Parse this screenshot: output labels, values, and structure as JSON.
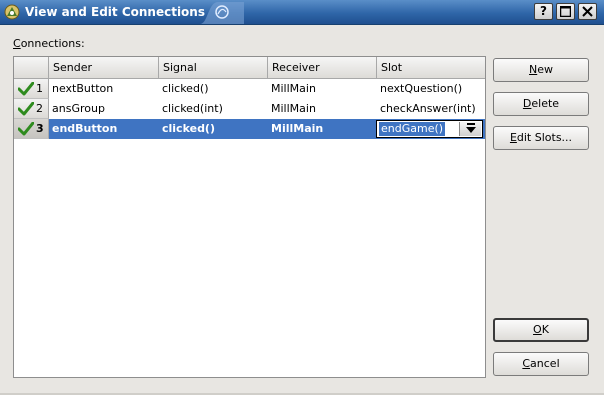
{
  "window": {
    "title": "View and Edit Connections",
    "help_label": "?"
  },
  "connections_label": "Connections:",
  "columns": [
    "Sender",
    "Signal",
    "Receiver",
    "Slot"
  ],
  "rows": [
    {
      "num": "1",
      "sender": "nextButton",
      "signal": "clicked()",
      "receiver": "MillMain",
      "slot": "nextQuestion()",
      "valid_icon": "check-icon"
    },
    {
      "num": "2",
      "sender": "ansGroup",
      "signal": "clicked(int)",
      "receiver": "MillMain",
      "slot": "checkAnswer(int)",
      "valid_icon": "check-icon"
    },
    {
      "num": "3",
      "sender": "endButton",
      "signal": "clicked()",
      "receiver": "MillMain",
      "slot": "endGame()",
      "valid_icon": "check-icon",
      "selected": true
    }
  ],
  "buttons": {
    "new": {
      "mnemonic": "N",
      "rest": "ew"
    },
    "delete": {
      "mnemonic": "D",
      "rest": "elete"
    },
    "edit_slots": {
      "mnemonic": "E",
      "rest": "dit Slots..."
    },
    "ok": {
      "mnemonic": "O",
      "rest": "K"
    },
    "cancel": {
      "mnemonic": "C",
      "rest": "ancel"
    }
  },
  "colors": {
    "selection": "#3f74c2",
    "titlebar": "#2f66a8",
    "check": "#2e8b1e"
  }
}
